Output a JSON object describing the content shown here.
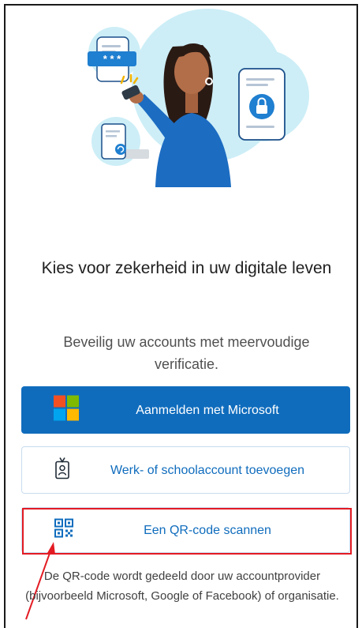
{
  "hero": {
    "pin_dots": "* * *"
  },
  "main": {
    "title": "Kies voor zekerheid in uw digitale leven",
    "subtitle": "Beveilig uw accounts met meervoudige verificatie."
  },
  "buttons": {
    "microsoft_label": "Aanmelden met Microsoft",
    "work_school_label": "Werk- of schoolaccount toevoegen",
    "qr_label": "Een QR-code scannen"
  },
  "footnote": "De QR-code wordt gedeeld door uw accountprovider (bijvoorbeeld Microsoft, Google of Facebook) of organisatie.",
  "icons": {
    "microsoft": "microsoft-logo-icon",
    "work_school": "id-badge-icon",
    "qr": "qr-code-icon"
  },
  "colors": {
    "primary": "#0f6cbd",
    "ms_red": "#f25022",
    "ms_green": "#7fba00",
    "ms_blue": "#00a4ef",
    "ms_yellow": "#ffb900",
    "highlight": "#e31b23",
    "illustration_bg": "#cdeef7"
  }
}
